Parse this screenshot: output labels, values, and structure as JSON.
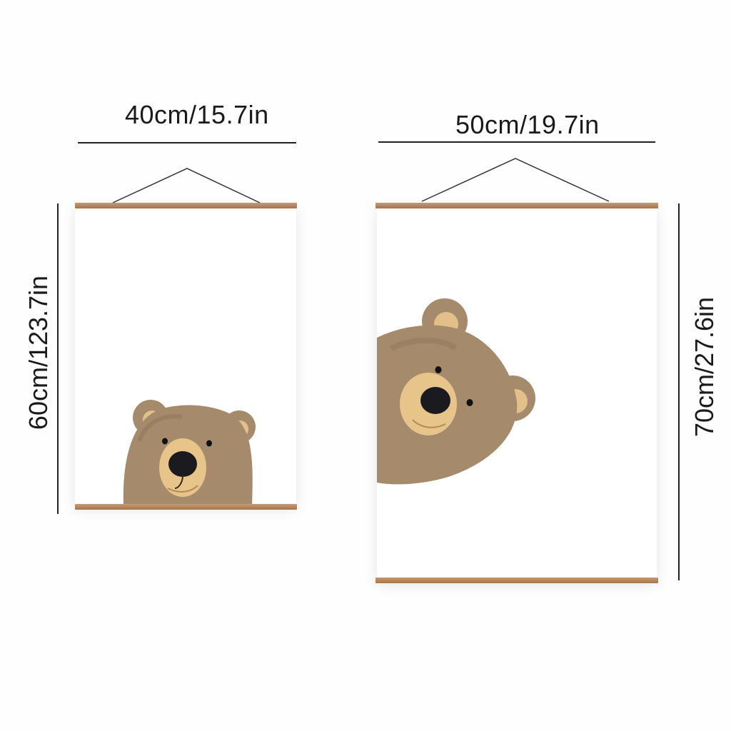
{
  "posters": [
    {
      "width_label": "40cm/15.7in",
      "height_label": "60cm/123.7in",
      "artwork": "bear-peeking-from-bottom"
    },
    {
      "width_label": "50cm/19.7in",
      "height_label": "70cm/27.6in",
      "artwork": "bear-peeking-from-left"
    }
  ],
  "colors": {
    "rail_wood": "#b07f58",
    "bear_fur": "#a58a6c",
    "bear_muzzle": "#e6c48a",
    "nose": "#1b1b1f",
    "line": "#222222"
  }
}
